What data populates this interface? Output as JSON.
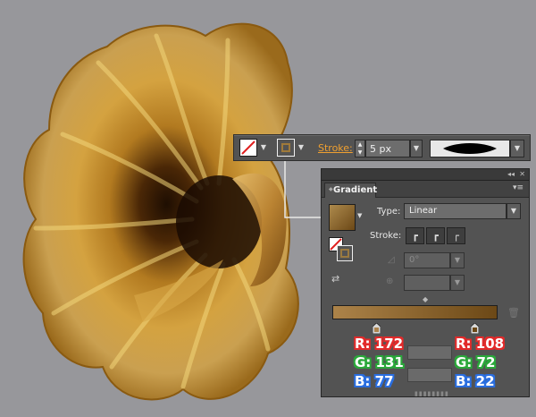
{
  "control_bar": {
    "stroke_label": "Stroke:",
    "stroke_weight": "5 px",
    "fill_icon": "none-swatch-icon",
    "stroke_icon": "stroke-swatch-icon"
  },
  "gradient_panel": {
    "tab_label": "Gradient",
    "type_label": "Type:",
    "type_value": "Linear",
    "stroke_label": "Stroke:",
    "angle_value": "0°",
    "gradient_start_color": "#ac8349",
    "gradient_end_color": "#6c4816",
    "icons": {
      "collapse": "collapse-icon",
      "close": "close-icon",
      "menu": "panel-menu-icon",
      "reverse": "reverse-gradient-icon",
      "angle": "angle-icon",
      "aspect": "aspect-ratio-icon",
      "delete": "delete-stop-icon"
    }
  },
  "callouts": {
    "left": {
      "r": "R: 172",
      "g": "G: 131",
      "b": "B: 77"
    },
    "right": {
      "r": "R: 108",
      "g": "G: 72",
      "b": "B: 22"
    }
  },
  "colors": {
    "callout_red": "#e22a2a",
    "callout_green": "#2aa83a",
    "callout_blue": "#2a6ee0",
    "stroke_label": "#f0a030"
  }
}
